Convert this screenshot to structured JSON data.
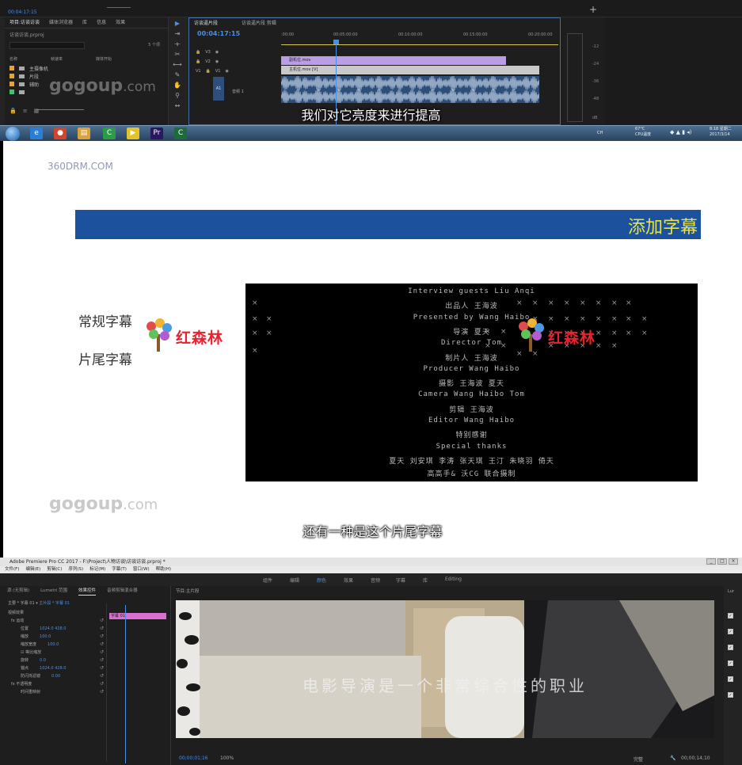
{
  "top_panel": {
    "timecode_top": "00:04:17:15",
    "project_tabs": [
      "项目:访谈访谈",
      "媒体浏览器",
      "库",
      "信息",
      "效果"
    ],
    "project_file": "访谈访谈.prproj",
    "item_count": "5 个项",
    "columns": [
      "名称",
      "帧速率",
      "媒体开始"
    ],
    "bins": [
      {
        "name": "主摄像机",
        "color": "#e6a23c"
      },
      {
        "name": "片段",
        "color": "#e6a23c"
      },
      {
        "name": "辅助",
        "color": "#e6a23c"
      },
      {
        "name": "",
        "color": "#3ec46d"
      }
    ],
    "timeline_tabs": [
      "访谈逼片段",
      "访谈逼片段 剪辑"
    ],
    "timeline_timecode": "00:04:17:15",
    "ruler": [
      ":00:00",
      "00:05:00:00",
      "00:10:00:00",
      "00:15:00:00",
      "00:20:00:00"
    ],
    "tracks": [
      {
        "name": "V3"
      },
      {
        "name": "V2"
      },
      {
        "name": "V1",
        "src": "V1"
      },
      {
        "name": "A1",
        "label": "音频 1"
      }
    ],
    "clips": {
      "v2": "副机位.mov",
      "v1": "主机位.mov [V]"
    },
    "meter_labels": [
      "-12",
      "-24",
      "-36",
      "-48",
      "dB"
    ],
    "watermark": "gogoup",
    "watermark_suffix": ".com",
    "subtitle": "我们对它亮度来进行提高"
  },
  "taskbar": {
    "icons": [
      {
        "name": "ie-icon",
        "glyph": "e",
        "color": "#2a7fd4"
      },
      {
        "name": "chrome-icon",
        "glyph": "●",
        "color": "#d4442a"
      },
      {
        "name": "folder-icon",
        "glyph": "▤",
        "color": "#d9a23a"
      },
      {
        "name": "camtasia-icon",
        "glyph": "C",
        "color": "#2a9c4a"
      },
      {
        "name": "player-icon",
        "glyph": "▶",
        "color": "#e6c229"
      },
      {
        "name": "premiere-icon",
        "glyph": "Pr",
        "color": "#2a1860"
      },
      {
        "name": "camtasia2-icon",
        "glyph": "C",
        "color": "#1e6b3a"
      }
    ],
    "lang": "CH",
    "temperature": "67°C",
    "cpu_label": "CPU温度",
    "time": "8:18 星期二",
    "date": "2017/3/14"
  },
  "slide": {
    "site_watermark": "360DRM.COM",
    "banner_title": "添加字幕",
    "label_regular": "常规字幕",
    "label_ending": "片尾字幕",
    "logo_text": "红森林",
    "credits": [
      "Interview guests Liu Anqi",
      "出品人 王海波",
      "Presented by Wang Haibo",
      "导演 夏天",
      "Director Tom",
      "制片人 王海波",
      "Producer Wang Haibo",
      "摄影 王海波 夏天",
      "Camera   Wang Haibo Tom",
      "剪辑 王海波",
      "Editor Wang Haibo",
      "特别感谢",
      "Special thanks",
      "夏天 刘安琪 李涛 张天琪 王汀 朱晓羽 倚天",
      "高高手& 沃CG 联合摄制"
    ],
    "watermark": "gogoup",
    "watermark_suffix": ".com",
    "subtitle": "还有一种是这个片尾字幕"
  },
  "bottom_panel": {
    "window_title": "Adobe Premiere Pro CC 2017 - F:\\Project\\人物访谈\\访谈访谈.prproj *",
    "menu": [
      "文件(F)",
      "编辑(E)",
      "剪辑(C)",
      "序列(S)",
      "标记(M)",
      "字幕(T)",
      "窗口(W)",
      "帮助(H)"
    ],
    "workspaces": [
      "组件",
      "编辑",
      "颜色",
      "效果",
      "音频",
      "字幕",
      "库",
      "Editing"
    ],
    "active_workspace": "颜色",
    "ec_tabs": [
      "源:(无剪辑)",
      "Lumetri 范围",
      "效果控件",
      "音频剪辑混合器"
    ],
    "ec_clip_path": "主要 * 字幕 01",
    "ec_seq_path": "主片段 * 字幕 01",
    "ec_clip_label": "字幕 01",
    "ec_section": "视频效果",
    "ec_rows": [
      {
        "label": "fx 运动",
        "value": ""
      },
      {
        "label": "位置",
        "value": "1024.0    428.0"
      },
      {
        "label": "缩放",
        "value": "100.0"
      },
      {
        "label": "缩放宽度",
        "value": "100.0"
      },
      {
        "label": "☑ 等比缩放",
        "value": ""
      },
      {
        "label": "旋转",
        "value": "0.0"
      },
      {
        "label": "锚点",
        "value": "1024.0    428.0"
      },
      {
        "label": "防闪烁滤镜",
        "value": "0.00"
      },
      {
        "label": "fx 不透明度",
        "value": ""
      },
      {
        "label": "时间重映射",
        "value": ""
      }
    ],
    "program_title": "节目:主片段",
    "video_subtitle": "电影导演是一个非常综合性的职业",
    "program_timecode": "00;00;01;16",
    "zoom": "100%",
    "quality": "完整",
    "duration": "00;00;14;10",
    "rail_label": "Lur"
  }
}
